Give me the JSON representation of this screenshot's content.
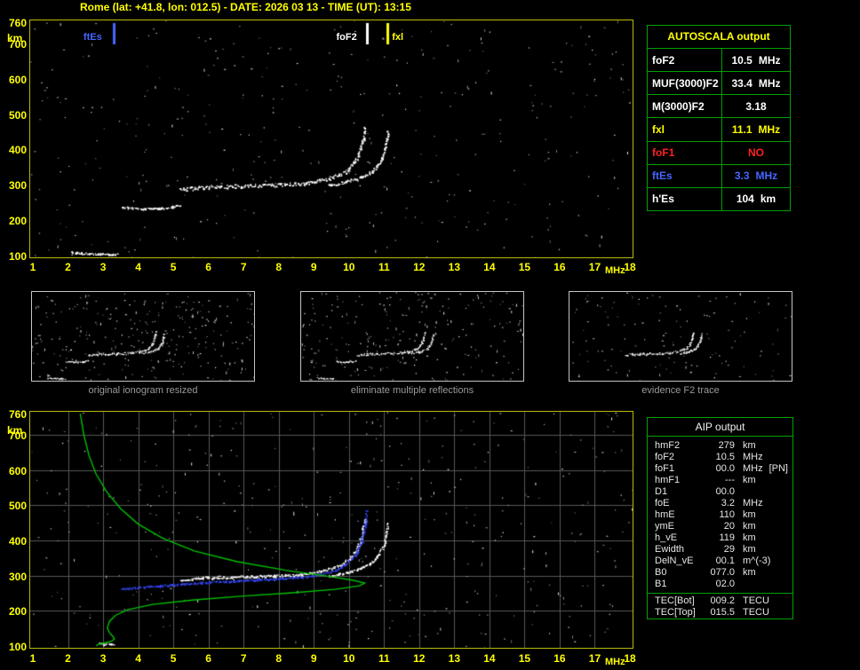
{
  "header": {
    "title": "Rome (lat: +41.8, lon: 012.5) - DATE: 2026 03 13 - TIME (UT): 13:15"
  },
  "autoscala": {
    "title": "AUTOSCALA output",
    "rows": [
      {
        "label": "foF2",
        "value": "10.5",
        "unit": "MHz",
        "color": "#ffffff"
      },
      {
        "label": "MUF(3000)F2",
        "value": "33.4",
        "unit": "MHz",
        "color": "#ffffff"
      },
      {
        "label": "M(3000)F2",
        "value": "3.18",
        "unit": "",
        "color": "#ffffff"
      },
      {
        "label": "fxl",
        "value": "11.1",
        "unit": "MHz",
        "color": "#ffff00"
      },
      {
        "label": "foF1",
        "value": "NO",
        "unit": "",
        "color": "#ff2020"
      },
      {
        "label": "ftEs",
        "value": "3.3",
        "unit": "MHz",
        "color": "#4466ff"
      },
      {
        "label": "h'Es",
        "value": "104",
        "unit": "km",
        "color": "#ffffff"
      }
    ]
  },
  "thumbnails": [
    {
      "caption": "original ionogram resized"
    },
    {
      "caption": "eliminate multiple reflections"
    },
    {
      "caption": "evidence F2 trace"
    }
  ],
  "aip": {
    "title": "AIP output",
    "rows": [
      {
        "label": "hmF2",
        "value": "279",
        "unit": "km",
        "extra": ""
      },
      {
        "label": "foF2",
        "value": "10.5",
        "unit": "MHz",
        "extra": ""
      },
      {
        "label": "foF1",
        "value": "00.0",
        "unit": "MHz",
        "extra": "[PN]"
      },
      {
        "label": "hmF1",
        "value": "---",
        "unit": "km",
        "extra": ""
      },
      {
        "label": "D1",
        "value": "00.0",
        "unit": "",
        "extra": ""
      },
      {
        "label": "foE",
        "value": "3.2",
        "unit": "MHz",
        "extra": ""
      },
      {
        "label": "hmE",
        "value": "110",
        "unit": "km",
        "extra": ""
      },
      {
        "label": "ymE",
        "value": "20",
        "unit": "km",
        "extra": ""
      },
      {
        "label": "h_vE",
        "value": "119",
        "unit": "km",
        "extra": ""
      },
      {
        "label": "Ewidth",
        "value": "29",
        "unit": "km",
        "extra": ""
      },
      {
        "label": "DelN_vE",
        "value": "00.1",
        "unit": "m^(-3)",
        "extra": ""
      },
      {
        "label": "B0",
        "value": "077.0",
        "unit": "km",
        "extra": ""
      },
      {
        "label": "B1",
        "value": "02.0",
        "unit": "",
        "extra": ""
      }
    ],
    "tec_rows": [
      {
        "label": "TEC[Bot]",
        "value": "009.2",
        "unit": "TECU"
      },
      {
        "label": "TEC[Top]",
        "value": "015.5",
        "unit": "TECU"
      }
    ]
  },
  "chart_data": [
    {
      "type": "scatter",
      "name": "scaled ionogram with autoscala markers",
      "xlabel": "MHz",
      "ylabel": "km",
      "xlim": [
        1,
        18
      ],
      "ylim": [
        100,
        760
      ],
      "xticks": [
        1,
        2,
        3,
        4,
        5,
        6,
        7,
        8,
        9,
        10,
        11,
        12,
        13,
        14,
        15,
        16,
        17,
        18
      ],
      "yticks": [
        100,
        200,
        300,
        400,
        500,
        600,
        700,
        760
      ],
      "grid": false,
      "markers": [
        {
          "name": "ftEs",
          "freq": 3.3,
          "color": "#4466ff",
          "side": "left"
        },
        {
          "name": "foF2",
          "freq": 10.5,
          "color": "#ffffff",
          "side": "left"
        },
        {
          "name": "fxl",
          "freq": 11.1,
          "color": "#ffff00",
          "side": "right"
        }
      ],
      "series": [
        {
          "name": "Es-trace",
          "color": "#ffffff",
          "thick": 2,
          "points": [
            [
              2.1,
              110
            ],
            [
              2.6,
              106
            ],
            [
              3.2,
              104
            ],
            [
              3.4,
              104
            ]
          ]
        },
        {
          "name": "F-trace-start",
          "color": "#ffffff",
          "thick": 2,
          "points": [
            [
              3.55,
              237
            ],
            [
              4.2,
              233
            ],
            [
              4.8,
              236
            ],
            [
              5.15,
              242
            ]
          ]
        },
        {
          "name": "O-mode-F2-trace",
          "color": "#ffffff",
          "thick": 4,
          "points": [
            [
              5.2,
              287
            ],
            [
              5.7,
              293
            ],
            [
              6.3,
              296
            ],
            [
              7.1,
              298
            ],
            [
              7.9,
              300
            ],
            [
              8.6,
              304
            ],
            [
              9.2,
              313
            ],
            [
              9.7,
              328
            ],
            [
              10.0,
              347
            ],
            [
              10.2,
              372
            ],
            [
              10.32,
              402
            ],
            [
              10.4,
              434
            ],
            [
              10.45,
              463
            ]
          ]
        },
        {
          "name": "X-mode-F2-trace",
          "color": "#ffffff",
          "thick": 3,
          "points": [
            [
              9.4,
              299
            ],
            [
              9.9,
              309
            ],
            [
              10.3,
              321
            ],
            [
              10.65,
              339
            ],
            [
              10.85,
              362
            ],
            [
              10.98,
              388
            ],
            [
              11.05,
              418
            ],
            [
              11.1,
              450
            ]
          ]
        }
      ]
    },
    {
      "type": "scatter",
      "name": "restored trace and electron density profile",
      "xlabel": "MHz",
      "ylabel": "km",
      "xlim": [
        1,
        18
      ],
      "ylim": [
        100,
        760
      ],
      "xticks": [
        1,
        2,
        3,
        4,
        5,
        6,
        7,
        8,
        9,
        10,
        11,
        12,
        13,
        14,
        15,
        16,
        17,
        18
      ],
      "yticks": [
        100,
        200,
        300,
        400,
        500,
        600,
        700,
        760
      ],
      "grid": true,
      "markers": [],
      "series": [
        {
          "name": "measured-O-trace",
          "color": "#ffffff",
          "thick": 3,
          "points": [
            [
              5.2,
              287
            ],
            [
              5.7,
              293
            ],
            [
              6.3,
              296
            ],
            [
              7.1,
              298
            ],
            [
              7.9,
              300
            ],
            [
              8.6,
              304
            ],
            [
              9.2,
              313
            ],
            [
              9.7,
              328
            ],
            [
              10.0,
              347
            ],
            [
              10.2,
              372
            ],
            [
              10.32,
              402
            ],
            [
              10.4,
              434
            ],
            [
              10.45,
              463
            ]
          ]
        },
        {
          "name": "measured-X-trace",
          "color": "#ffffff",
          "thick": 2,
          "points": [
            [
              9.4,
              299
            ],
            [
              9.9,
              309
            ],
            [
              10.3,
              321
            ],
            [
              10.65,
              339
            ],
            [
              10.85,
              362
            ],
            [
              10.98,
              388
            ],
            [
              11.05,
              418
            ],
            [
              11.1,
              450
            ]
          ]
        },
        {
          "name": "restored-trace",
          "color": "#3344ee",
          "thick": 2,
          "points": [
            [
              3.5,
              262
            ],
            [
              4.0,
              267
            ],
            [
              4.6,
              272
            ],
            [
              5.2,
              276
            ],
            [
              5.8,
              281
            ],
            [
              6.6,
              285
            ],
            [
              7.4,
              289
            ],
            [
              8.2,
              293
            ],
            [
              8.9,
              299
            ],
            [
              9.5,
              312
            ],
            [
              9.9,
              332
            ],
            [
              10.2,
              362
            ],
            [
              10.35,
              400
            ],
            [
              10.45,
              442
            ],
            [
              10.5,
              485
            ]
          ]
        },
        {
          "name": "Es-blob",
          "color": "#ffffff",
          "thick": 3,
          "points": [
            [
              2.85,
              107
            ],
            [
              3.25,
              104
            ]
          ]
        },
        {
          "name": "electron-density-profile",
          "color": "#00c000",
          "style": "line",
          "points": [
            [
              2.35,
              760
            ],
            [
              2.45,
              700
            ],
            [
              2.6,
              640
            ],
            [
              2.8,
              588
            ],
            [
              3.1,
              538
            ],
            [
              3.5,
              490
            ],
            [
              4.0,
              446
            ],
            [
              4.7,
              406
            ],
            [
              5.6,
              370
            ],
            [
              6.8,
              340
            ],
            [
              8.2,
              315
            ],
            [
              9.4,
              298
            ],
            [
              10.1,
              287
            ],
            [
              10.45,
              279
            ],
            [
              10.3,
              271
            ],
            [
              9.6,
              261
            ],
            [
              8.4,
              251
            ],
            [
              7.0,
              242
            ],
            [
              5.6,
              231
            ],
            [
              4.4,
              218
            ],
            [
              3.7,
              203
            ],
            [
              3.35,
              187
            ],
            [
              3.18,
              170
            ],
            [
              3.12,
              152
            ],
            [
              3.18,
              138
            ],
            [
              3.28,
              127
            ],
            [
              3.32,
              120
            ],
            [
              3.25,
              114
            ],
            [
              3.1,
              110
            ],
            [
              2.9,
              106
            ],
            [
              2.8,
              101
            ]
          ]
        }
      ]
    }
  ]
}
